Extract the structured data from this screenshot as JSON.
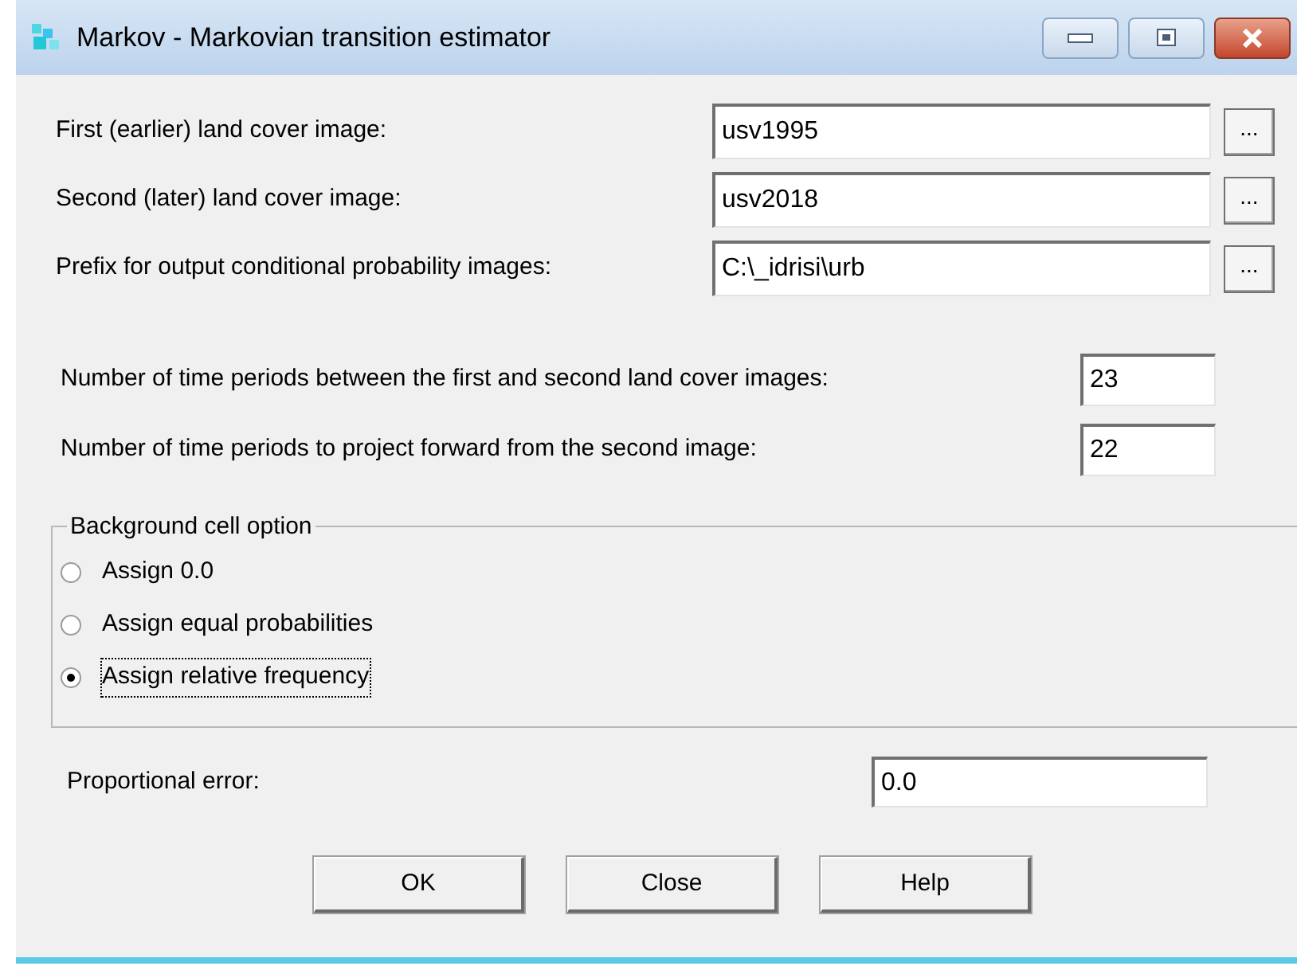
{
  "window": {
    "title": "Markov - Markovian transition estimator"
  },
  "file_fields": [
    {
      "label": "First (earlier) land cover image:",
      "value": "usv1995",
      "browse": "..."
    },
    {
      "label": "Second (later) land cover image:",
      "value": "usv2018",
      "browse": "..."
    },
    {
      "label": "Prefix for output conditional probability images:",
      "value": "C:\\_idrisi\\urb",
      "browse": "..."
    }
  ],
  "period_fields": [
    {
      "label": "Number of time periods between the first and second land cover images:",
      "value": "23"
    },
    {
      "label": "Number of time periods to project forward from the second image:",
      "value": "22"
    }
  ],
  "background_group": {
    "title": "Background cell option",
    "options": [
      {
        "label": "Assign 0.0",
        "selected": false
      },
      {
        "label": "Assign equal probabilities",
        "selected": false
      },
      {
        "label": "Assign relative frequency",
        "selected": true
      }
    ]
  },
  "proportional_error": {
    "label": "Proportional error:",
    "value": "0.0"
  },
  "buttons": [
    "OK",
    "Close",
    "Help"
  ]
}
